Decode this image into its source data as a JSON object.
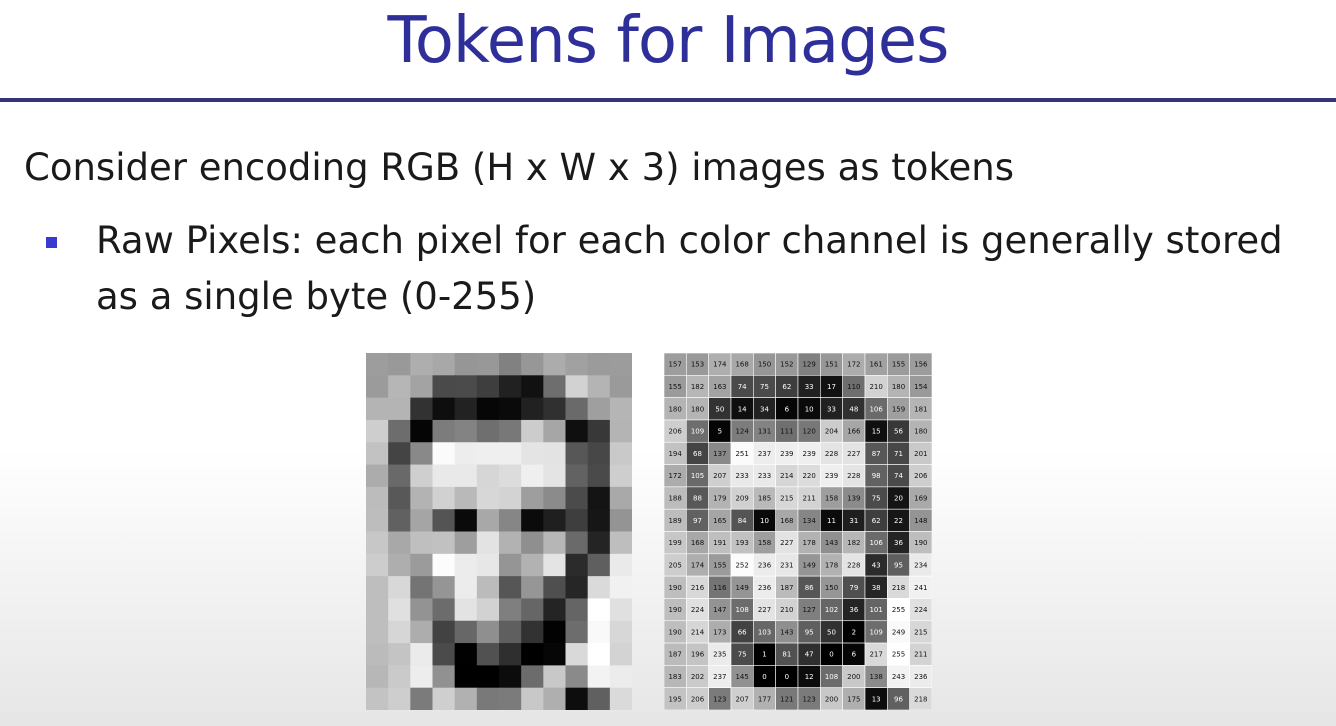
{
  "slide": {
    "title": "Tokens for Images",
    "intro": "Consider encoding RGB (H x W x 3) images as tokens",
    "bullet": "Raw Pixels: each pixel for each color channel is generally stored as a single byte (0-255)"
  },
  "colors": {
    "title": "#2f2f9a",
    "rule": "#35357a",
    "bullet": "#3a3ad0"
  },
  "pixel_grid": {
    "rows": 16,
    "cols": 12,
    "values": [
      [
        157,
        153,
        174,
        168,
        150,
        152,
        129,
        151,
        172,
        161,
        155,
        156
      ],
      [
        155,
        182,
        163,
        74,
        75,
        62,
        33,
        17,
        110,
        210,
        180,
        154
      ],
      [
        180,
        180,
        50,
        14,
        34,
        6,
        10,
        33,
        48,
        106,
        159,
        181
      ],
      [
        206,
        109,
        5,
        124,
        131,
        111,
        120,
        204,
        166,
        15,
        56,
        180
      ],
      [
        194,
        68,
        137,
        251,
        237,
        239,
        239,
        228,
        227,
        87,
        71,
        201
      ],
      [
        172,
        105,
        207,
        233,
        233,
        214,
        220,
        239,
        228,
        98,
        74,
        206
      ],
      [
        188,
        88,
        179,
        209,
        185,
        215,
        211,
        158,
        139,
        75,
        20,
        169
      ],
      [
        189,
        97,
        165,
        84,
        10,
        168,
        134,
        11,
        31,
        62,
        22,
        148
      ],
      [
        199,
        168,
        191,
        193,
        158,
        227,
        178,
        143,
        182,
        106,
        36,
        190
      ],
      [
        205,
        174,
        155,
        252,
        236,
        231,
        149,
        178,
        228,
        43,
        95,
        234
      ],
      [
        190,
        216,
        116,
        149,
        236,
        187,
        86,
        150,
        79,
        38,
        218,
        241
      ],
      [
        190,
        224,
        147,
        108,
        227,
        210,
        127,
        102,
        36,
        101,
        255,
        224
      ],
      [
        190,
        214,
        173,
        66,
        103,
        143,
        95,
        50,
        2,
        109,
        249,
        215
      ],
      [
        187,
        196,
        235,
        75,
        1,
        81,
        47,
        0,
        6,
        217,
        255,
        211
      ],
      [
        183,
        202,
        237,
        145,
        0,
        0,
        12,
        108,
        200,
        138,
        243,
        236
      ],
      [
        195,
        206,
        123,
        207,
        177,
        121,
        123,
        200,
        175,
        13,
        96,
        218
      ]
    ]
  }
}
